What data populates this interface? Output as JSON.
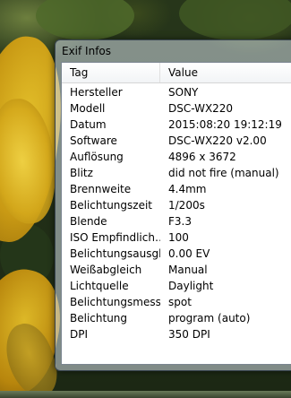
{
  "window": {
    "title": "Exif Infos"
  },
  "table": {
    "headers": {
      "tag": "Tag",
      "value": "Value"
    },
    "rows": [
      {
        "tag": "Hersteller",
        "value": "SONY"
      },
      {
        "tag": "Modell",
        "value": "DSC-WX220"
      },
      {
        "tag": "Datum",
        "value": "2015:08:20 19:12:19"
      },
      {
        "tag": "Software",
        "value": "DSC-WX220 v2.00"
      },
      {
        "tag": "Auflösung",
        "value": "4896 x 3672"
      },
      {
        "tag": "Blitz",
        "value": "did not fire (manual)"
      },
      {
        "tag": "Brennweite",
        "value": "4.4mm"
      },
      {
        "tag": "Belichtungszeit",
        "value": "1/200s"
      },
      {
        "tag": "Blende",
        "value": "F3.3"
      },
      {
        "tag": "ISO Empfindlich…",
        "value": "100"
      },
      {
        "tag": "Belichtungsausgl…",
        "value": "0.00 EV"
      },
      {
        "tag": "Weißabgleich",
        "value": "Manual"
      },
      {
        "tag": "Lichtquelle",
        "value": "Daylight"
      },
      {
        "tag": "Belichtungsmess…",
        "value": "spot"
      },
      {
        "tag": "Belichtung",
        "value": "program (auto)"
      },
      {
        "tag": "DPI",
        "value": "350 DPI"
      }
    ]
  }
}
